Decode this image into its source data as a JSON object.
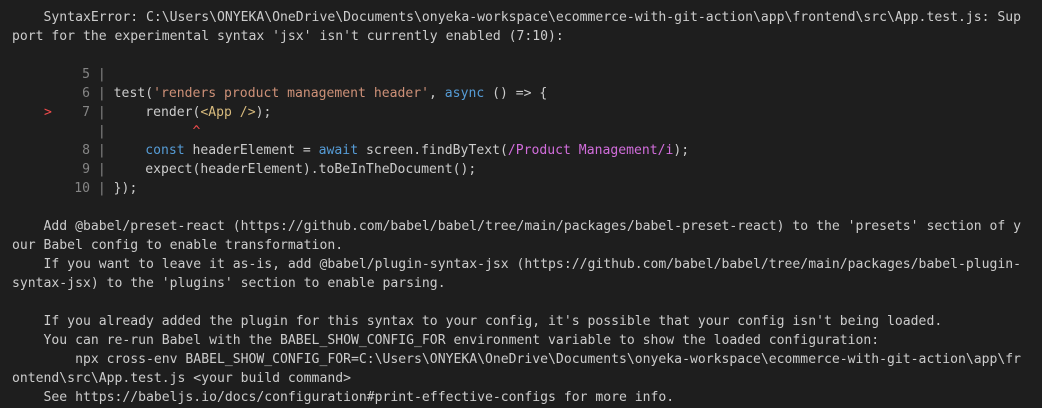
{
  "error": {
    "line1": "    SyntaxError: C:\\Users\\ONYEKA\\OneDrive\\Documents\\onyeka-workspace\\ecommerce-with-git-action\\app\\frontend\\src\\App.test.js: Sup",
    "line2": "port for the experimental syntax 'jsx' isn't currently enabled (7:10):"
  },
  "code_frame": {
    "marker": ">",
    "bar": "|",
    "line_numbers": [
      "5",
      "6",
      "7",
      "8",
      "9",
      "10"
    ],
    "l6": {
      "test": "test(",
      "string": "'renders product management header'",
      "comma": ", ",
      "async": "async",
      "rest": " () => {"
    },
    "l7": {
      "render": "    render(",
      "jsx": "<App />",
      "rest": ");"
    },
    "caret": "^",
    "l8": {
      "indent": "    ",
      "const": "const",
      "mid": " headerElement = ",
      "await": "await",
      "call": " screen.findByText(",
      "regex": "/Product Management/i",
      "rest": ");"
    },
    "l9": "    expect(headerElement).toBeInTheDocument();",
    "l10": "});"
  },
  "help": {
    "p1a": "    Add @babel/preset-react (https://github.com/babel/babel/tree/main/packages/babel-preset-react) to the 'presets' section of y",
    "p1b": "our Babel config to enable transformation.",
    "p2a": "    If you want to leave it as-is, add @babel/plugin-syntax-jsx (https://github.com/babel/babel/tree/main/packages/babel-plugin-",
    "p2b": "syntax-jsx) to the 'plugins' section to enable parsing.",
    "p3": "    If you already added the plugin for this syntax to your config, it's possible that your config isn't being loaded.",
    "p4": "    You can re-run Babel with the BABEL_SHOW_CONFIG_FOR environment variable to show the loaded configuration:",
    "p5a": "        npx cross-env BABEL_SHOW_CONFIG_FOR=C:\\Users\\ONYEKA\\OneDrive\\Documents\\onyeka-workspace\\ecommerce-with-git-action\\app\\fr",
    "p5b": "ontend\\src\\App.test.js <your build command>",
    "p6": "    See https://babeljs.io/docs/configuration#print-effective-configs for more info."
  }
}
